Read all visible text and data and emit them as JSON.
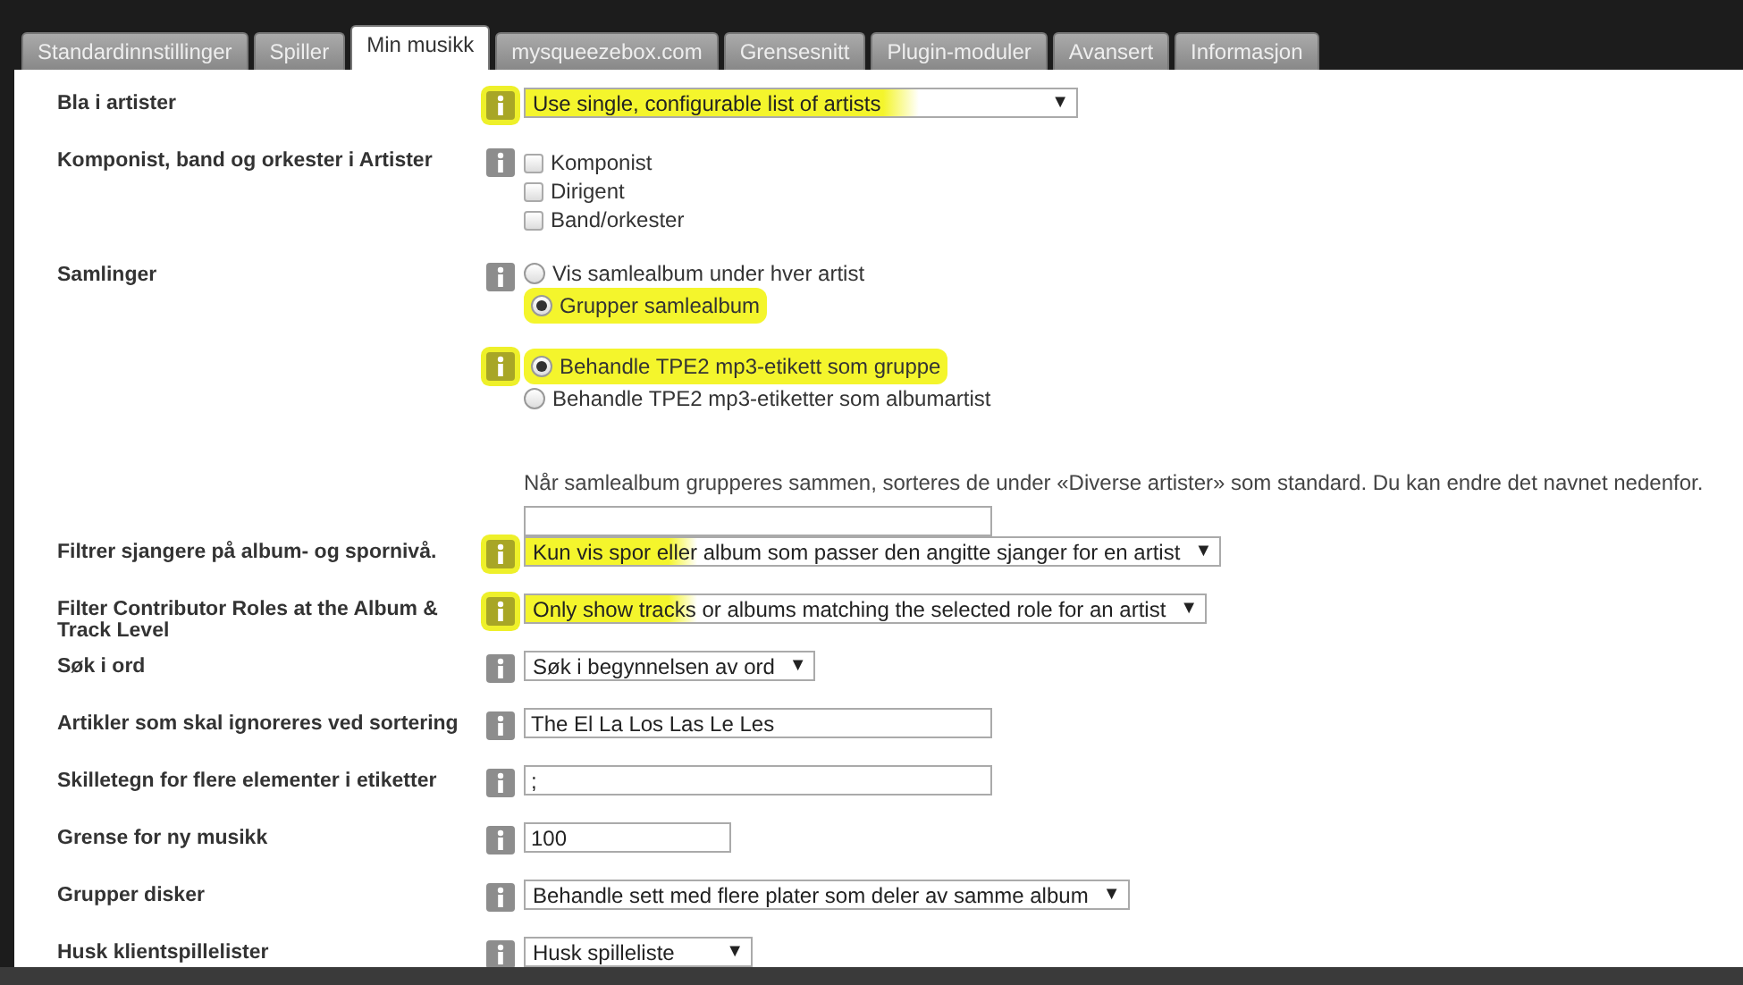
{
  "tabs": [
    {
      "label": "Standardinnstillinger",
      "selected": false
    },
    {
      "label": "Spiller",
      "selected": false
    },
    {
      "label": "Min musikk",
      "selected": true
    },
    {
      "label": "mysqueezebox.com",
      "selected": false
    },
    {
      "label": "Grensesnitt",
      "selected": false
    },
    {
      "label": "Plugin-moduler",
      "selected": false
    },
    {
      "label": "Avansert",
      "selected": false
    },
    {
      "label": "Informasjon",
      "selected": false
    }
  ],
  "settings": [
    {
      "kind": "wide_select",
      "label": "Bla i artister",
      "value": "Use single, configurable list of artists",
      "highlighted": true,
      "arrow": "▼"
    },
    {
      "kind": "checkboxes",
      "label": "Komponist, band og orkester i Artister",
      "options": [
        {
          "label": "Komponist",
          "checked": false
        },
        {
          "label": "Dirigent",
          "checked": false
        },
        {
          "label": "Band/orkester",
          "checked": false
        }
      ]
    },
    {
      "kind": "radios",
      "label": "Samlinger",
      "groups": [
        {
          "highlighted": false,
          "options": [
            {
              "label": "Vis samlealbum under hver artist",
              "selected": false,
              "highlighted": false
            },
            {
              "label": "Grupper samlealbum",
              "selected": true,
              "highlighted": true
            }
          ]
        },
        {
          "highlighted": true,
          "options": [
            {
              "label": "Behandle TPE2 mp3-etikett som gruppe",
              "selected": true,
              "highlighted": true
            },
            {
              "label": "Behandle TPE2 mp3-etiketter som albumartist",
              "selected": false,
              "highlighted": false
            }
          ]
        }
      ],
      "note": "Når samlealbum grupperes sammen, sorteres de under «Diverse artister» som standard. Du kan endre det navnet nedenfor.",
      "name_field": true
    },
    {
      "kind": "select",
      "label": "Filtrer sjangere på album- og spornivå.",
      "value": "Kun vis spor eller album som passer den angitte sjanger for en artist",
      "highlighted": true,
      "arrow": "▼"
    },
    {
      "kind": "select",
      "label": "Filter Contributor Roles at the Album & Track Level",
      "value": "Only show tracks or albums matching the selected role for an artist",
      "highlighted": true,
      "arrow": "▼"
    },
    {
      "kind": "select",
      "label": "Søk i ord",
      "value": "Søk i begynnelsen av ord",
      "highlighted": false,
      "arrow": "▼"
    },
    {
      "kind": "text",
      "label": "Artikler som skal ignoreres ved sortering",
      "value": "The El La Los Las Le Les"
    },
    {
      "kind": "text",
      "label": "Skilletegn for flere elementer i etiketter",
      "value": ";"
    },
    {
      "kind": "number",
      "label": "Grense for ny musikk",
      "value": "100"
    },
    {
      "kind": "select",
      "label": "Grupper disker",
      "value": "Behandle sett med flere plater som deler av samme album",
      "highlighted": false,
      "arrow": "▼"
    },
    {
      "kind": "select",
      "label": "Husk klientspillelister",
      "value": "Husk spilleliste",
      "highlighted": false,
      "arrow": "▼"
    }
  ]
}
